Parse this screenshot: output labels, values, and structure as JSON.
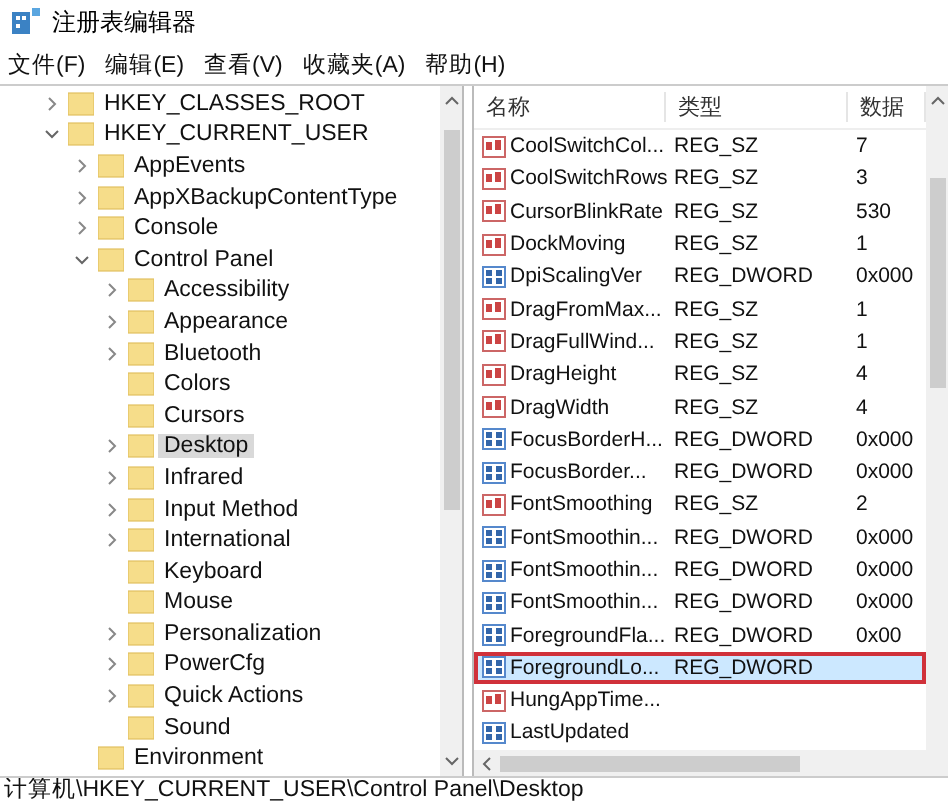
{
  "window": {
    "title": "注册表编辑器"
  },
  "menu": [
    "文件(F)",
    "编辑(E)",
    "查看(V)",
    "收藏夹(A)",
    "帮助(H)"
  ],
  "tree": [
    {
      "label": "HKEY_CLASSES_ROOT",
      "kind": "branch",
      "expanded": false,
      "selected": false
    },
    {
      "label": "HKEY_CURRENT_USER",
      "kind": "branch",
      "expanded": true,
      "selected": false,
      "children": [
        {
          "label": "AppEvents",
          "kind": "branch",
          "expanded": false,
          "selected": false
        },
        {
          "label": "AppXBackupContentType",
          "kind": "branch",
          "expanded": false,
          "selected": false
        },
        {
          "label": "Console",
          "kind": "branch",
          "expanded": false,
          "selected": false
        },
        {
          "label": "Control Panel",
          "kind": "branch",
          "expanded": true,
          "selected": false,
          "children": [
            {
              "label": "Accessibility",
              "kind": "branch",
              "expanded": false,
              "selected": false
            },
            {
              "label": "Appearance",
              "kind": "branch",
              "expanded": false,
              "selected": false
            },
            {
              "label": "Bluetooth",
              "kind": "branch",
              "expanded": false,
              "selected": false
            },
            {
              "label": "Colors",
              "kind": "leaf",
              "selected": false
            },
            {
              "label": "Cursors",
              "kind": "leaf",
              "selected": false
            },
            {
              "label": "Desktop",
              "kind": "branch",
              "expanded": false,
              "selected": true
            },
            {
              "label": "Infrared",
              "kind": "branch",
              "expanded": false,
              "selected": false
            },
            {
              "label": "Input Method",
              "kind": "branch",
              "expanded": false,
              "selected": false
            },
            {
              "label": "International",
              "kind": "branch",
              "expanded": false,
              "selected": false
            },
            {
              "label": "Keyboard",
              "kind": "leaf",
              "selected": false
            },
            {
              "label": "Mouse",
              "kind": "leaf",
              "selected": false
            },
            {
              "label": "Personalization",
              "kind": "branch",
              "expanded": false,
              "selected": false
            },
            {
              "label": "PowerCfg",
              "kind": "branch",
              "expanded": false,
              "selected": false
            },
            {
              "label": "Quick Actions",
              "kind": "branch",
              "expanded": false,
              "selected": false
            },
            {
              "label": "Sound",
              "kind": "leaf",
              "selected": false
            }
          ]
        },
        {
          "label": "Environment",
          "kind": "leaf",
          "selected": false
        }
      ]
    }
  ],
  "table": {
    "columns": [
      "名称",
      "类型",
      "数据"
    ],
    "rows": [
      {
        "kind": "string",
        "name": "CoolSwitchCol...",
        "type": "REG_SZ",
        "data": "7",
        "selected": false,
        "outlined": false
      },
      {
        "kind": "string",
        "name": "CoolSwitchRows",
        "type": "REG_SZ",
        "data": "3",
        "selected": false,
        "outlined": false
      },
      {
        "kind": "string",
        "name": "CursorBlinkRate",
        "type": "REG_SZ",
        "data": "530",
        "selected": false,
        "outlined": false
      },
      {
        "kind": "string",
        "name": "DockMoving",
        "type": "REG_SZ",
        "data": "1",
        "selected": false,
        "outlined": false
      },
      {
        "kind": "binary",
        "name": "DpiScalingVer",
        "type": "REG_DWORD",
        "data": "0x000",
        "selected": false,
        "outlined": false
      },
      {
        "kind": "string",
        "name": "DragFromMax...",
        "type": "REG_SZ",
        "data": "1",
        "selected": false,
        "outlined": false
      },
      {
        "kind": "string",
        "name": "DragFullWind...",
        "type": "REG_SZ",
        "data": "1",
        "selected": false,
        "outlined": false
      },
      {
        "kind": "string",
        "name": "DragHeight",
        "type": "REG_SZ",
        "data": "4",
        "selected": false,
        "outlined": false
      },
      {
        "kind": "string",
        "name": "DragWidth",
        "type": "REG_SZ",
        "data": "4",
        "selected": false,
        "outlined": false
      },
      {
        "kind": "binary",
        "name": "FocusBorderH...",
        "type": "REG_DWORD",
        "data": "0x000",
        "selected": false,
        "outlined": false
      },
      {
        "kind": "binary",
        "name": "FocusBorder...",
        "type": "REG_DWORD",
        "data": "0x000",
        "selected": false,
        "outlined": false
      },
      {
        "kind": "string",
        "name": "FontSmoothing",
        "type": "REG_SZ",
        "data": "2",
        "selected": false,
        "outlined": false
      },
      {
        "kind": "binary",
        "name": "FontSmoothin...",
        "type": "REG_DWORD",
        "data": "0x000",
        "selected": false,
        "outlined": false
      },
      {
        "kind": "binary",
        "name": "FontSmoothin...",
        "type": "REG_DWORD",
        "data": "0x000",
        "selected": false,
        "outlined": false
      },
      {
        "kind": "binary",
        "name": "FontSmoothin...",
        "type": "REG_DWORD",
        "data": "0x000",
        "selected": false,
        "outlined": false
      },
      {
        "kind": "binary",
        "name": "ForegroundFla...",
        "type": "REG_DWORD",
        "data": "0x00",
        "selected": false,
        "outlined": false
      },
      {
        "kind": "binary",
        "name": "ForegroundLo...",
        "type": "REG_DWORD",
        "selected": true,
        "outlined": true
      },
      {
        "kind": "string",
        "name": "HungAppTime...",
        "selected": false,
        "outlined": false
      },
      {
        "kind": "binary",
        "name": "LastUpdated",
        "selected": false,
        "outlined": false
      }
    ]
  },
  "status_bar": "计算机\\HKEY_CURRENT_USER\\Control Panel\\Desktop"
}
